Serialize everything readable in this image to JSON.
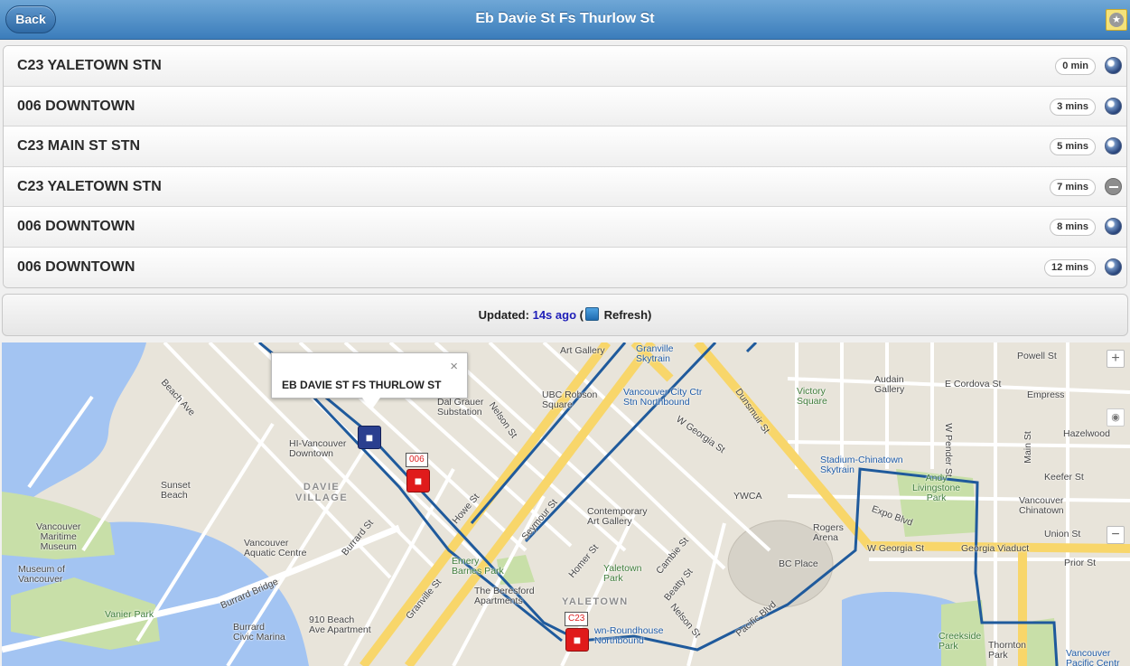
{
  "header": {
    "back_label": "Back",
    "title": "Eb Davie St Fs Thurlow St",
    "favorite_icon": "star-icon"
  },
  "arrivals": [
    {
      "route": "C23 YALETOWN STN",
      "eta": "0 min",
      "status_icon": "live-gps-icon"
    },
    {
      "route": "006 DOWNTOWN",
      "eta": "3 mins",
      "status_icon": "live-gps-icon"
    },
    {
      "route": "C23 MAIN ST STN",
      "eta": "5 mins",
      "status_icon": "live-gps-icon"
    },
    {
      "route": "C23 YALETOWN STN",
      "eta": "7 mins",
      "status_icon": "scheduled-minus-icon"
    },
    {
      "route": "006 DOWNTOWN",
      "eta": "8 mins",
      "status_icon": "live-gps-icon"
    },
    {
      "route": "006 DOWNTOWN",
      "eta": "12 mins",
      "status_icon": "live-gps-icon"
    }
  ],
  "updated": {
    "prefix": "Updated:",
    "ago": "14s ago",
    "open_paren": "(",
    "refresh_label": "Refresh)"
  },
  "map": {
    "popup_title": "EB DAVIE ST FS THURLOW ST",
    "popup_close": "×",
    "bus_tags": [
      "006",
      "C23"
    ],
    "zoom_in": "+",
    "zoom_out": "−",
    "labels": {
      "art_gallery": "Art Gallery",
      "granville_skytrain": "Granville\nSkytrain",
      "powell_st": "Powell St",
      "audain_gallery": "Audain\nGallery",
      "e_cordova_st": "E Cordova St",
      "empress": "Empress",
      "hazelwood": "Hazelwood",
      "victory_square": "Victory\nSquare",
      "dal_grauer": "Dal Grauer\nSubstation",
      "ubc_robson": "UBC Robson\nSquare",
      "vcc_skytrain": "Vancouver City Ctr\nStn Northbound",
      "w_pender_st": "W Pender St",
      "dunsmuir_st": "Dunsmuir St",
      "w_georgia_st": "W Georgia St",
      "w_georgia_st_2": "W Georgia St",
      "stadium_chinatown": "Stadium-Chinatown\nSkytrain",
      "andy_livingstone": "Andy\nLivingstone\nPark",
      "vancouver_chinatown": "Vancouver\nChinatown",
      "keefer_st": "Keefer St",
      "union_st": "Union St",
      "prior_st": "Prior St",
      "main_st": "Main St",
      "hi_vancouver": "HI-Vancouver\nDowntown",
      "davie_village": "DAVIE\nVILLAGE",
      "beach_ave": "Beach Ave",
      "sunset_beach": "Sunset\nBeach",
      "vancouver_maritime": "Vancouver\nMaritime\nMuseum",
      "vancouver_aquatic": "Vancouver\nAquatic Centre",
      "museum_of_vancouver": "Museum of\nVancouver",
      "vanier_park": "Vanier Park",
      "burrard_bridge": "Burrard Bridge",
      "burrard_marina": "Burrard\nCivic Marina",
      "910_beach": "910 Beach\nAve Apartment",
      "burrard_st": "Burrard St",
      "nelson_st": "Nelson St",
      "howe_st": "Howe St",
      "seymour_st": "Seymour St",
      "granville_st": "Granville St",
      "contemporary_art": "Contemporary\nArt Gallery",
      "emery_barnes": "Emery\nBarnes Park",
      "the_beresford": "The Beresford\nApartments",
      "yaletown_park": "Yaletown\nPark",
      "yaletown": "YALETOWN",
      "ywca": "YWCA",
      "rogers_arena": "Rogers\nArena",
      "bc_place": "BC Place",
      "expo_blvd": "Expo Blvd",
      "georgia_viaduct": "Georgia Viaduct",
      "pacific_blvd": "Pacific Blvd",
      "creekside_park": "Creekside\nPark",
      "thornton_park": "Thornton\nPark",
      "vancouver_pacific": "Vancouver\nPacific Centr",
      "roundhouse": "wn-Roundhouse\nNorthbound",
      "nelson_st_2": "Nelson St",
      "cambie_st": "Cambie St",
      "homer_st": "Homer St",
      "beatty_st": "Beatty St"
    }
  },
  "colors": {
    "header_top": "#6fa7d6",
    "header_bottom": "#3b7dbb",
    "route_line": "#1f5a9c",
    "bus_red": "#e01b1b",
    "bus_blue": "#2a3f8f",
    "updated_ago": "#1e1eb8",
    "water": "#a3c4f2",
    "park": "#c8dfa8",
    "major_road": "#f8d66a"
  }
}
